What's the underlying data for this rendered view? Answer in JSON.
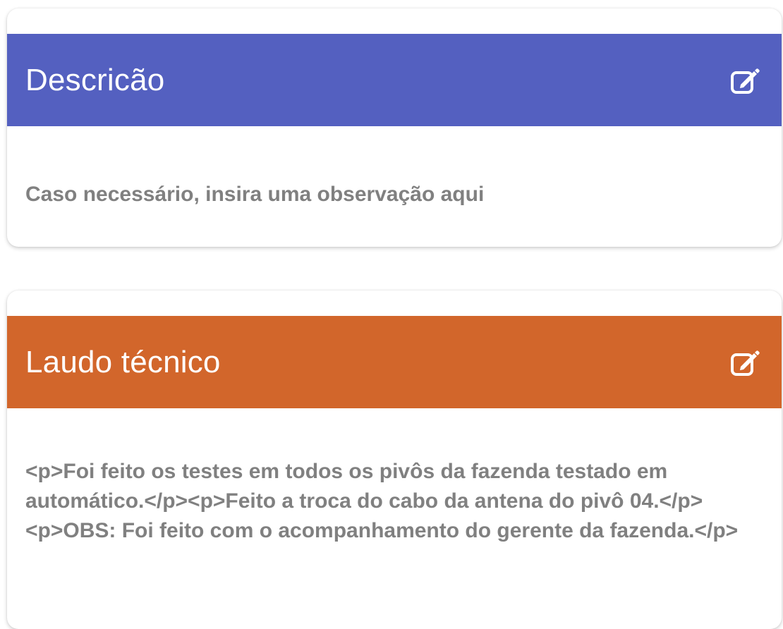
{
  "colors": {
    "descricao_header": "#5460C0",
    "laudo_header": "#D2662B",
    "body_text": "#808080"
  },
  "descricao": {
    "title": "Descricão",
    "edit_icon": "edit-icon",
    "placeholder": "Caso necessário, insira uma observação aqui"
  },
  "laudo": {
    "title": "Laudo técnico",
    "edit_icon": "edit-icon",
    "text": "<p>Foi feito os testes em todos os pivôs da fazenda testado em automático.</p><p>Feito a troca do cabo da antena do pivô 04.</p><p>OBS: Foi feito com o acompanhamento do gerente da fazenda.</p>"
  }
}
